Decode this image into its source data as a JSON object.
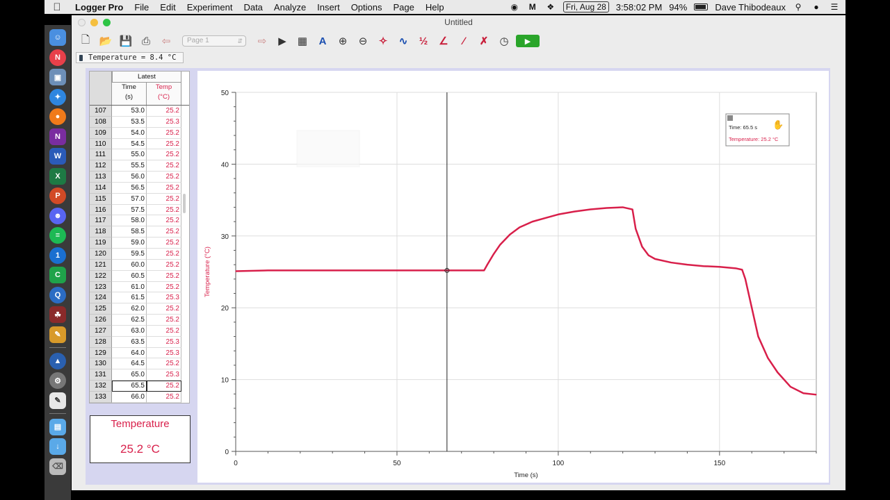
{
  "menubar": {
    "app_name": "Logger Pro",
    "menus": [
      "File",
      "Edit",
      "Experiment",
      "Data",
      "Analyze",
      "Insert",
      "Options",
      "Page",
      "Help"
    ],
    "date": "Fri, Aug 28",
    "time": "3:58:02 PM",
    "battery": "94%",
    "user": "Dave Thibodeaux"
  },
  "window": {
    "title": "Untitled",
    "page_select": "Page 1",
    "sensor_readout": "Temperature = 8.4 °C"
  },
  "table": {
    "group_header": "Latest",
    "col_time": "Time",
    "col_time_unit": "(s)",
    "col_temp": "Temp",
    "col_temp_unit": "(°C)",
    "rows": [
      {
        "n": "107",
        "t": "53.0",
        "v": "25.2"
      },
      {
        "n": "108",
        "t": "53.5",
        "v": "25.3"
      },
      {
        "n": "109",
        "t": "54.0",
        "v": "25.2"
      },
      {
        "n": "110",
        "t": "54.5",
        "v": "25.2"
      },
      {
        "n": "111",
        "t": "55.0",
        "v": "25.2"
      },
      {
        "n": "112",
        "t": "55.5",
        "v": "25.2"
      },
      {
        "n": "113",
        "t": "56.0",
        "v": "25.2"
      },
      {
        "n": "114",
        "t": "56.5",
        "v": "25.2"
      },
      {
        "n": "115",
        "t": "57.0",
        "v": "25.2"
      },
      {
        "n": "116",
        "t": "57.5",
        "v": "25.2"
      },
      {
        "n": "117",
        "t": "58.0",
        "v": "25.2"
      },
      {
        "n": "118",
        "t": "58.5",
        "v": "25.2"
      },
      {
        "n": "119",
        "t": "59.0",
        "v": "25.2"
      },
      {
        "n": "120",
        "t": "59.5",
        "v": "25.2"
      },
      {
        "n": "121",
        "t": "60.0",
        "v": "25.2"
      },
      {
        "n": "122",
        "t": "60.5",
        "v": "25.2"
      },
      {
        "n": "123",
        "t": "61.0",
        "v": "25.2"
      },
      {
        "n": "124",
        "t": "61.5",
        "v": "25.3"
      },
      {
        "n": "125",
        "t": "62.0",
        "v": "25.2"
      },
      {
        "n": "126",
        "t": "62.5",
        "v": "25.2"
      },
      {
        "n": "127",
        "t": "63.0",
        "v": "25.2"
      },
      {
        "n": "128",
        "t": "63.5",
        "v": "25.3"
      },
      {
        "n": "129",
        "t": "64.0",
        "v": "25.3"
      },
      {
        "n": "130",
        "t": "64.5",
        "v": "25.2"
      },
      {
        "n": "131",
        "t": "65.0",
        "v": "25.3"
      },
      {
        "n": "132",
        "t": "65.5",
        "v": "25.2",
        "selected": true
      },
      {
        "n": "133",
        "t": "66.0",
        "v": "25.2"
      }
    ]
  },
  "meter": {
    "label": "Temperature",
    "value": "25.2 °C"
  },
  "examine": {
    "time_line": "Time: 65.5 s",
    "temp_line": "Temperature: 25.2 °C"
  },
  "colors": {
    "series": "#d81f4a",
    "panel_bg": "#d6d6f0"
  },
  "chart_data": {
    "type": "line",
    "title": "",
    "xlabel": "Time (s)",
    "ylabel": "Temperature (°C)",
    "xlim": [
      0,
      180
    ],
    "ylim": [
      0,
      50
    ],
    "x_ticks": [
      0,
      50,
      100,
      150
    ],
    "y_ticks": [
      0,
      10,
      20,
      30,
      40,
      50
    ],
    "grid": true,
    "cursor_x": 65.5,
    "series": [
      {
        "name": "Temperature",
        "x": [
          0,
          10,
          20,
          30,
          40,
          50,
          60,
          65.5,
          70,
          77,
          78,
          80,
          82,
          85,
          88,
          92,
          96,
          100,
          105,
          110,
          115,
          120,
          123,
          124,
          126,
          128,
          130,
          135,
          140,
          145,
          150,
          155,
          157,
          158,
          160,
          162,
          165,
          168,
          172,
          176,
          180
        ],
        "y": [
          25.1,
          25.2,
          25.2,
          25.2,
          25.2,
          25.2,
          25.2,
          25.2,
          25.2,
          25.2,
          26.0,
          27.5,
          28.8,
          30.2,
          31.2,
          32.0,
          32.5,
          33.0,
          33.4,
          33.7,
          33.9,
          34.0,
          33.7,
          31.0,
          28.5,
          27.3,
          26.8,
          26.3,
          26.0,
          25.8,
          25.7,
          25.5,
          25.3,
          24.0,
          20.0,
          16.0,
          13.0,
          11.0,
          9.0,
          8.1,
          7.9
        ]
      }
    ]
  }
}
